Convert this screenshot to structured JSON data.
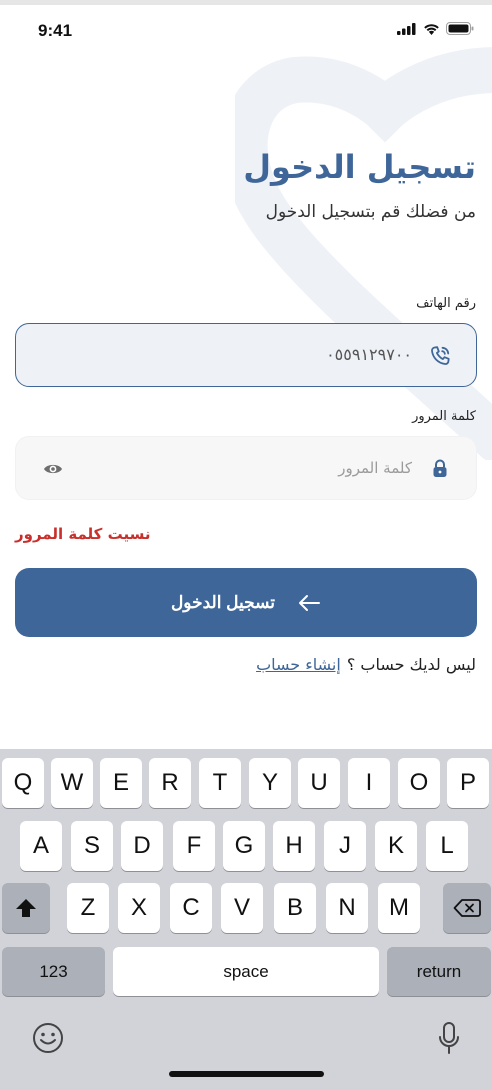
{
  "status_bar": {
    "time": "9:41"
  },
  "login": {
    "title": "تسجيل الدخول",
    "subtitle": "من فضلك قم بتسجيل الدخول",
    "phone_label": "رقم الهاتف",
    "phone_value": "٠٥٥٩١٢٩٧٠٠",
    "password_label": "كلمة المرور",
    "password_placeholder": "كلمة المرور",
    "forgot_password": "نسيت كلمة المرور",
    "login_button": "تسجيل الدخول",
    "no_account_text": "ليس لديك حساب ؟",
    "create_account_link": "إنشاء حساب"
  },
  "colors": {
    "primary": "#3f6699",
    "error": "#c9302c",
    "keyboard_bg": "#d1d3d9"
  },
  "keyboard": {
    "row1": [
      "Q",
      "W",
      "E",
      "R",
      "T",
      "Y",
      "U",
      "I",
      "O",
      "P"
    ],
    "row2": [
      "A",
      "S",
      "D",
      "F",
      "G",
      "H",
      "J",
      "K",
      "L"
    ],
    "row3": [
      "Z",
      "X",
      "C",
      "V",
      "B",
      "N",
      "M"
    ],
    "numbers_key": "123",
    "space_key": "space",
    "return_key": "return"
  }
}
